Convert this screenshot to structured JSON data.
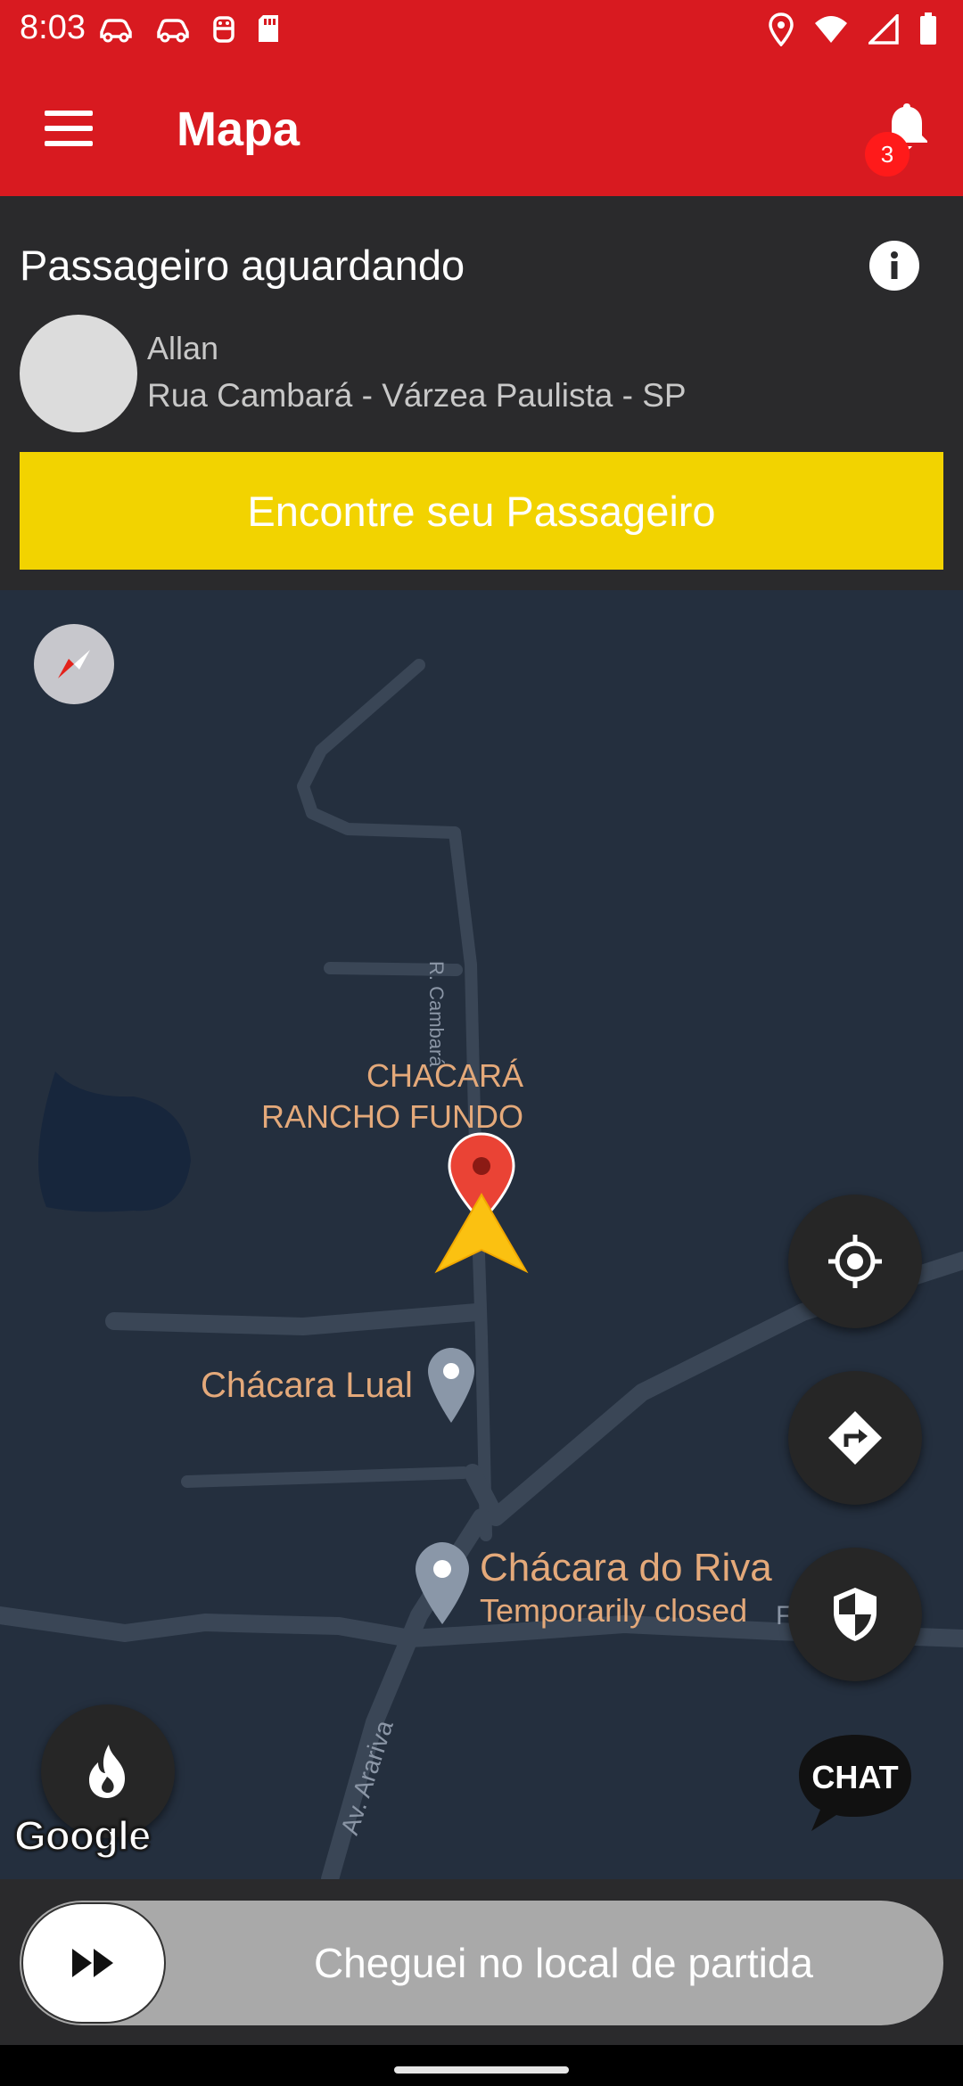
{
  "status_bar": {
    "time": "8:03",
    "left_icons": [
      "car-icon",
      "car-icon",
      "robot-icon",
      "sd-card-icon"
    ],
    "right_icons": [
      "location-icon",
      "wifi-icon",
      "signal-icon",
      "battery-icon"
    ]
  },
  "app_bar": {
    "title": "Mapa",
    "notification_count": "3",
    "colors": {
      "background": "#d81a20",
      "badge": "#ff1a1a"
    }
  },
  "passenger_panel": {
    "title": "Passageiro aguardando",
    "passenger_name": "Allan",
    "passenger_address": "Rua Cambará - Várzea Paulista - SP",
    "find_button_label": "Encontre seu Passageiro",
    "colors": {
      "find_button": "#f2d300"
    }
  },
  "map": {
    "places": {
      "chacara_rancho_line1": "CHACARÁ",
      "chacara_rancho_line2": "RANCHO FUNDO",
      "chacara_lual": "Chácara Lual",
      "chacara_riva": "Chácara do Riva",
      "chacara_riva_status": "Temporarily closed"
    },
    "streets": {
      "r_cambara": "R. Cambará",
      "av_arariva": "Av. Arariva"
    },
    "attribution": "Google",
    "chat_label": "CHAT",
    "fab_icons": [
      "crosshair-icon",
      "directions-icon",
      "shield-icon",
      "flame-icon"
    ]
  },
  "bottom": {
    "slider_label": "Cheguei no local de partida",
    "slider_icon": "fast-forward-icon"
  }
}
